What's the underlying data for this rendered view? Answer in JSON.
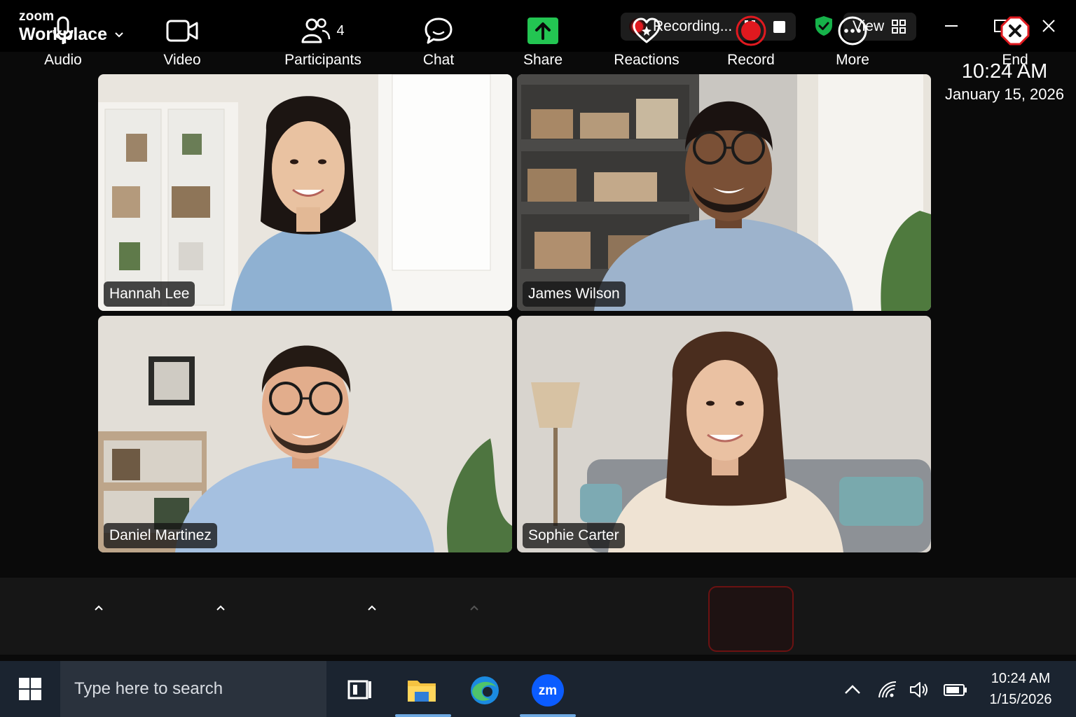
{
  "window": {
    "brand_small": "zoom",
    "brand_big": "Workplace",
    "recording_label": "Recording...",
    "view_label": "View"
  },
  "clock": {
    "time": "10:24 AM",
    "date": "January 15, 2026"
  },
  "participants": [
    {
      "name": "Hannah Lee"
    },
    {
      "name": "James Wilson"
    },
    {
      "name": "Daniel Martinez"
    },
    {
      "name": "Sophie Carter"
    }
  ],
  "toolbar": {
    "audio": "Audio",
    "video": "Video",
    "participants": "Participants",
    "participants_count": "4",
    "chat": "Chat",
    "share": "Share",
    "reactions": "Reactions",
    "record": "Record",
    "more": "More",
    "end": "End"
  },
  "taskbar": {
    "search_placeholder": "Type here to search",
    "time": "10:24 AM",
    "date": "1/15/2026"
  },
  "colors": {
    "record_red": "#e0191f",
    "share_green": "#23c552",
    "shield_green": "#16b24a",
    "zoom_blue": "#0b5cff"
  }
}
